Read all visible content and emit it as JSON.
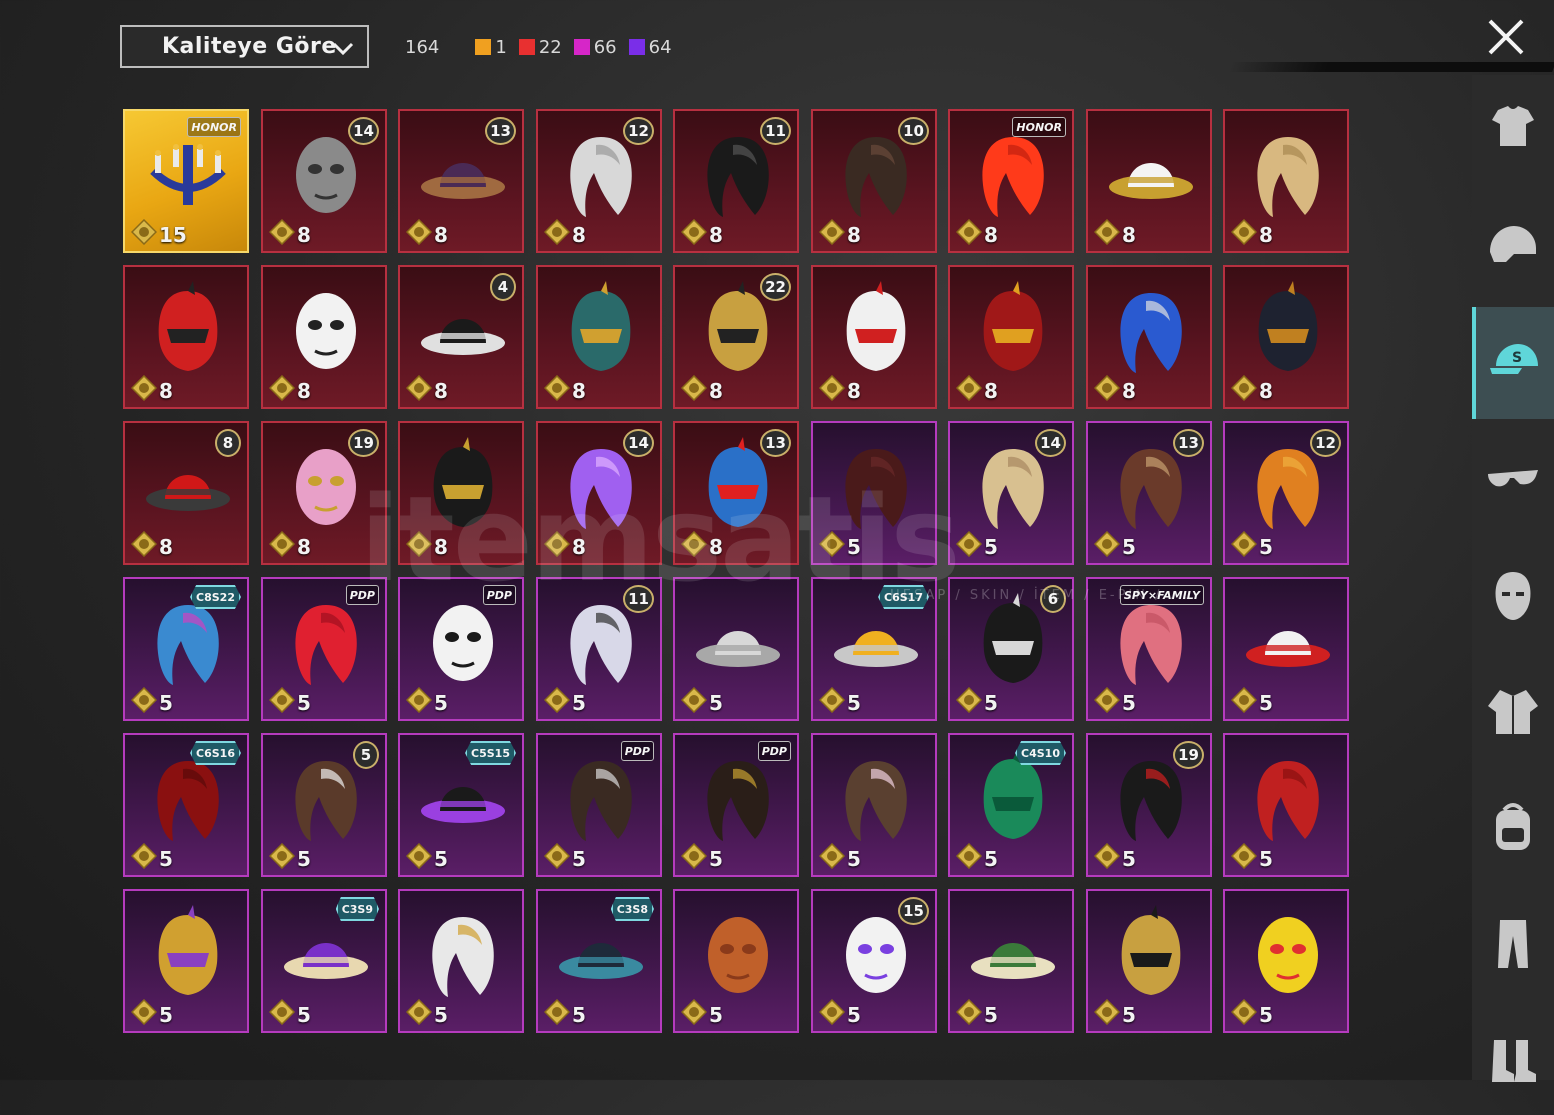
{
  "toolbar": {
    "sort_label": "Kaliteye Göre",
    "total_count": "164",
    "quality_counts": [
      {
        "color": "#f0a020",
        "count": "1"
      },
      {
        "color": "#e83030",
        "count": "22"
      },
      {
        "color": "#d626c8",
        "count": "66"
      },
      {
        "color": "#7a2ee8",
        "count": "64"
      }
    ]
  },
  "watermark": {
    "text": "itemsatis",
    "sub": "HESAP / SKIN / İTEM / E-PIN / ..."
  },
  "items": [
    {
      "tier": "gold",
      "price": "15",
      "badge": "HONOR",
      "badge_type": "tag",
      "art": "candelabra",
      "c1": "#2a3a9a",
      "c2": "#f0c040"
    },
    {
      "tier": "red",
      "price": "8",
      "badge": "14",
      "badge_type": "level",
      "art": "mask",
      "c1": "#8a8a8a",
      "c2": "#333"
    },
    {
      "tier": "red",
      "price": "8",
      "badge": "13",
      "badge_type": "level",
      "art": "hat",
      "c1": "#4a2a55",
      "c2": "#a06a40"
    },
    {
      "tier": "red",
      "price": "8",
      "badge": "12",
      "badge_type": "level",
      "art": "hair",
      "c1": "#d8d8d8",
      "c2": "#9a9a9a"
    },
    {
      "tier": "red",
      "price": "8",
      "badge": "11",
      "badge_type": "level",
      "art": "hair",
      "c1": "#1a1a1a",
      "c2": "#555"
    },
    {
      "tier": "red",
      "price": "8",
      "badge": "10",
      "badge_type": "level",
      "art": "hair",
      "c1": "#3a2a22",
      "c2": "#6a4a3a"
    },
    {
      "tier": "red",
      "price": "8",
      "badge": "HONOR",
      "badge_type": "tag",
      "art": "hair",
      "c1": "#ff3a1a",
      "c2": "#c02010"
    },
    {
      "tier": "red",
      "price": "8",
      "badge": "",
      "badge_type": "",
      "art": "hat",
      "c1": "#f4f4f4",
      "c2": "#c8a030"
    },
    {
      "tier": "red",
      "price": "8",
      "badge": "",
      "badge_type": "",
      "art": "hair",
      "c1": "#d8b880",
      "c2": "#a88850"
    },
    {
      "tier": "red",
      "price": "8",
      "badge": "",
      "badge_type": "",
      "art": "helmet",
      "c1": "#d02020",
      "c2": "#222"
    },
    {
      "tier": "red",
      "price": "8",
      "badge": "",
      "badge_type": "",
      "art": "mask",
      "c1": "#f2f2f2",
      "c2": "#222"
    },
    {
      "tier": "red",
      "price": "8",
      "badge": "4",
      "badge_type": "level",
      "art": "hat",
      "c1": "#1a1a1a",
      "c2": "#e0e0e0"
    },
    {
      "tier": "red",
      "price": "8",
      "badge": "",
      "badge_type": "",
      "art": "helmet",
      "c1": "#2a6a6a",
      "c2": "#d0a030"
    },
    {
      "tier": "red",
      "price": "8",
      "badge": "22",
      "badge_type": "level",
      "art": "helmet",
      "c1": "#c8a040",
      "c2": "#222"
    },
    {
      "tier": "red",
      "price": "8",
      "badge": "",
      "badge_type": "",
      "art": "helmet",
      "c1": "#f0f0f0",
      "c2": "#d02020"
    },
    {
      "tier": "red",
      "price": "8",
      "badge": "",
      "badge_type": "",
      "art": "helmet",
      "c1": "#a01818",
      "c2": "#e0a020"
    },
    {
      "tier": "red",
      "price": "8",
      "badge": "",
      "badge_type": "",
      "art": "hair",
      "c1": "#2a5ad0",
      "c2": "#e0e0e0"
    },
    {
      "tier": "red",
      "price": "8",
      "badge": "",
      "badge_type": "",
      "art": "helmet",
      "c1": "#1e2230",
      "c2": "#c08020"
    },
    {
      "tier": "red",
      "price": "8",
      "badge": "8",
      "badge_type": "level",
      "art": "hat",
      "c1": "#d01818",
      "c2": "#3a3a3a"
    },
    {
      "tier": "red",
      "price": "8",
      "badge": "19",
      "badge_type": "level",
      "art": "mask",
      "c1": "#e8a0c8",
      "c2": "#c8a030"
    },
    {
      "tier": "red",
      "price": "8",
      "badge": "",
      "badge_type": "",
      "art": "helmet",
      "c1": "#1a1a1a",
      "c2": "#c8a030"
    },
    {
      "tier": "red",
      "price": "8",
      "badge": "14",
      "badge_type": "level",
      "art": "hair",
      "c1": "#a060f0",
      "c2": "#e0b0ff"
    },
    {
      "tier": "red",
      "price": "8",
      "badge": "13",
      "badge_type": "level",
      "art": "helmet",
      "c1": "#2a70c8",
      "c2": "#e02020"
    },
    {
      "tier": "purple",
      "price": "5",
      "badge": "",
      "badge_type": "",
      "art": "hair",
      "c1": "#4a1a1a",
      "c2": "#6a2a2a"
    },
    {
      "tier": "purple",
      "price": "5",
      "badge": "14",
      "badge_type": "level",
      "art": "hair",
      "c1": "#d8c090",
      "c2": "#a88860"
    },
    {
      "tier": "purple",
      "price": "5",
      "badge": "13",
      "badge_type": "level",
      "art": "hair",
      "c1": "#6a3a2a",
      "c2": "#c8a070"
    },
    {
      "tier": "purple",
      "price": "5",
      "badge": "12",
      "badge_type": "level",
      "art": "hair",
      "c1": "#e08020",
      "c2": "#f0b040"
    },
    {
      "tier": "purple",
      "price": "5",
      "badge": "C8S22",
      "badge_type": "season",
      "art": "hair",
      "c1": "#3a8ad0",
      "c2": "#d040c0"
    },
    {
      "tier": "purple",
      "price": "5",
      "badge": "PDP",
      "badge_type": "tag",
      "art": "hair",
      "c1": "#e02030",
      "c2": "#a01020"
    },
    {
      "tier": "purple",
      "price": "5",
      "badge": "PDP",
      "badge_type": "tag",
      "art": "mask",
      "c1": "#f2f2f2",
      "c2": "#1a1a1a"
    },
    {
      "tier": "purple",
      "price": "5",
      "badge": "11",
      "badge_type": "level",
      "art": "hair",
      "c1": "#d8d8e8",
      "c2": "#303030"
    },
    {
      "tier": "purple",
      "price": "5",
      "badge": "",
      "badge_type": "",
      "art": "hat",
      "c1": "#d8d8d8",
      "c2": "#a8a8a8"
    },
    {
      "tier": "purple",
      "price": "5",
      "badge": "C6S17",
      "badge_type": "season",
      "art": "hat",
      "c1": "#f0b020",
      "c2": "#c8c8c8"
    },
    {
      "tier": "purple",
      "price": "5",
      "badge": "6",
      "badge_type": "level",
      "art": "helmet",
      "c1": "#1a1a1a",
      "c2": "#d8d8d8"
    },
    {
      "tier": "purple",
      "price": "5",
      "badge": "SPY×FAMILY",
      "badge_type": "tag",
      "art": "hair",
      "c1": "#e07080",
      "c2": "#c05060"
    },
    {
      "tier": "purple",
      "price": "5",
      "badge": "",
      "badge_type": "",
      "art": "hat",
      "c1": "#f2f2f2",
      "c2": "#d02020"
    },
    {
      "tier": "purple",
      "price": "5",
      "badge": "C6S16",
      "badge_type": "season",
      "art": "hair",
      "c1": "#8a1010",
      "c2": "#5a0a0a"
    },
    {
      "tier": "purple",
      "price": "5",
      "badge": "5",
      "badge_type": "level",
      "art": "hair",
      "c1": "#5a3a2a",
      "c2": "#f0f0f0"
    },
    {
      "tier": "purple",
      "price": "5",
      "badge": "C5S15",
      "badge_type": "season",
      "art": "hat",
      "c1": "#1a1a1a",
      "c2": "#9a40e0"
    },
    {
      "tier": "purple",
      "price": "5",
      "badge": "PDP",
      "badge_type": "tag",
      "art": "hair",
      "c1": "#3a2a22",
      "c2": "#d8d8d8"
    },
    {
      "tier": "purple",
      "price": "5",
      "badge": "PDP",
      "badge_type": "tag",
      "art": "hair",
      "c1": "#2a1e18",
      "c2": "#c8a030"
    },
    {
      "tier": "purple",
      "price": "5",
      "badge": "",
      "badge_type": "",
      "art": "hair",
      "c1": "#5a4030",
      "c2": "#f0d0e0"
    },
    {
      "tier": "purple",
      "price": "5",
      "badge": "C4S10",
      "badge_type": "season",
      "art": "helmet",
      "c1": "#1a8a5a",
      "c2": "#0a5a3a"
    },
    {
      "tier": "purple",
      "price": "5",
      "badge": "19",
      "badge_type": "level",
      "art": "hair",
      "c1": "#1a1a1a",
      "c2": "#d02020"
    },
    {
      "tier": "purple",
      "price": "5",
      "badge": "",
      "badge_type": "",
      "art": "hair",
      "c1": "#c02020",
      "c2": "#8a1010"
    },
    {
      "tier": "purple",
      "price": "5",
      "badge": "",
      "badge_type": "",
      "art": "helmet",
      "c1": "#d0a030",
      "c2": "#8a40c0"
    },
    {
      "tier": "purple",
      "price": "5",
      "badge": "C3S9",
      "badge_type": "season",
      "art": "hat",
      "c1": "#7a30c8",
      "c2": "#e8d8b0"
    },
    {
      "tier": "purple",
      "price": "5",
      "badge": "",
      "badge_type": "",
      "art": "hair",
      "c1": "#e8e8e8",
      "c2": "#d0a030"
    },
    {
      "tier": "purple",
      "price": "5",
      "badge": "C3S8",
      "badge_type": "season",
      "art": "hat",
      "c1": "#1e2a3a",
      "c2": "#3a8aa0"
    },
    {
      "tier": "purple",
      "price": "5",
      "badge": "",
      "badge_type": "",
      "art": "mask",
      "c1": "#c0602a",
      "c2": "#8a3a1a"
    },
    {
      "tier": "purple",
      "price": "5",
      "badge": "15",
      "badge_type": "level",
      "art": "mask",
      "c1": "#f2f2f2",
      "c2": "#7a40e0"
    },
    {
      "tier": "purple",
      "price": "5",
      "badge": "",
      "badge_type": "",
      "art": "hat",
      "c1": "#3a7a3a",
      "c2": "#e8e0c0"
    },
    {
      "tier": "purple",
      "price": "5",
      "badge": "",
      "badge_type": "",
      "art": "helmet",
      "c1": "#c8a040",
      "c2": "#1a1a1a"
    },
    {
      "tier": "purple",
      "price": "5",
      "badge": "",
      "badge_type": "",
      "art": "mask",
      "c1": "#f0d020",
      "c2": "#e03030"
    }
  ],
  "sidebar": [
    {
      "name": "outfit-icon"
    },
    {
      "name": "helmet-icon"
    },
    {
      "name": "cap-icon",
      "active": true
    },
    {
      "name": "glasses-icon"
    },
    {
      "name": "face-mask-icon"
    },
    {
      "name": "jacket-icon"
    },
    {
      "name": "backpack-icon"
    },
    {
      "name": "pants-icon"
    },
    {
      "name": "boots-icon"
    }
  ]
}
